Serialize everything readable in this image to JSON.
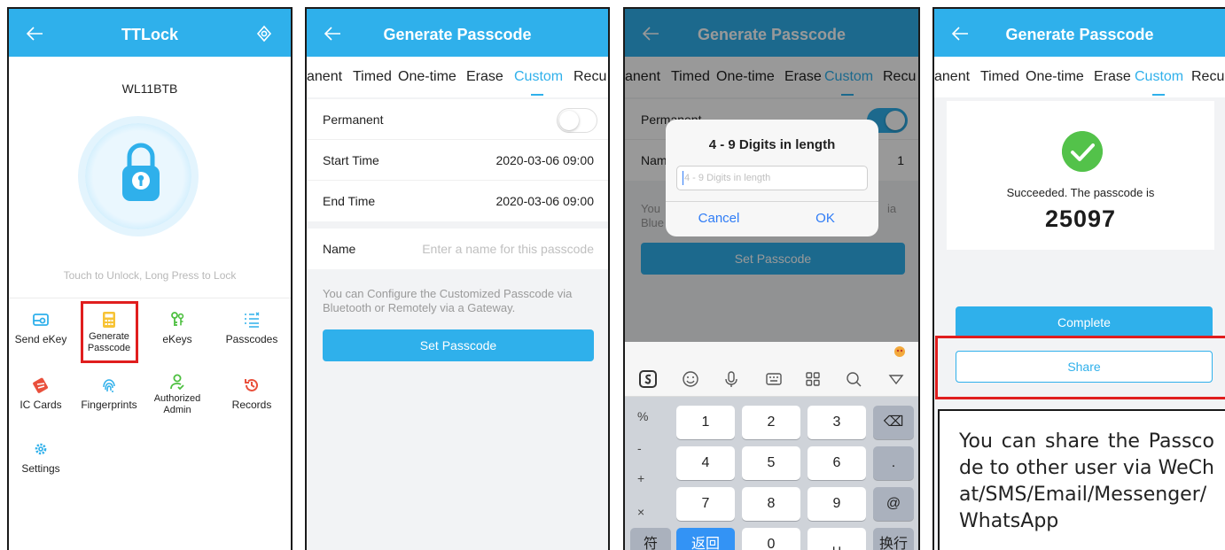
{
  "panel1": {
    "title": "TTLock",
    "lock_name": "WL11BTB",
    "unlock_hint": "Touch to Unlock, Long Press to Lock",
    "grid": [
      {
        "label": "Send eKey",
        "icon": "send-ekey-icon"
      },
      {
        "label": "Generate Passcode",
        "icon": "calculator-icon"
      },
      {
        "label": "eKeys",
        "icon": "keys-icon"
      },
      {
        "label": "Passcodes",
        "icon": "passcodes-list-icon"
      },
      {
        "label": "IC Cards",
        "icon": "ic-card-icon"
      },
      {
        "label": "Fingerprints",
        "icon": "fingerprint-icon"
      },
      {
        "label": "Authorized Admin",
        "icon": "admin-user-icon"
      },
      {
        "label": "Records",
        "icon": "records-history-icon"
      },
      {
        "label": "Settings",
        "icon": "settings-gear-icon"
      }
    ],
    "colors": {
      "header": "#2fb0eb",
      "highlight": "#e01e1e"
    }
  },
  "panel2": {
    "title": "Generate Passcode",
    "tabs": [
      "anent",
      "Timed",
      "One-time",
      "Erase",
      "Custom",
      "Recu"
    ],
    "active_tab": "Custom",
    "permanent_label": "Permanent",
    "start_label": "Start Time",
    "start_value": "2020-03-06 09:00",
    "end_label": "End Time",
    "end_value": "2020-03-06 09:00",
    "name_label": "Name",
    "name_placeholder": "Enter a name for this passcode",
    "note": "You can Configure the Customized Passcode via Bluetooth or Remotely via a Gateway.",
    "button": "Set Passcode"
  },
  "panel3": {
    "title": "Generate Passcode",
    "tabs": [
      "anent",
      "Timed",
      "One-time",
      "Erase",
      "Custom",
      "Recu"
    ],
    "bg_permanent": "Permanent",
    "bg_name": "Nam",
    "bg_name_value": "1",
    "bg_note_left1": "You",
    "bg_note_left2": "Blue",
    "bg_note_right": "ia",
    "bg_button": "Set Passcode",
    "dialog_title": "4 - 9 Digits in length",
    "dialog_placeholder": "4 - 9 Digits in length",
    "dialog_cancel": "Cancel",
    "dialog_ok": "OK",
    "keyboard": {
      "side": [
        "%",
        "-",
        "+",
        "×"
      ],
      "rows": [
        [
          "1",
          "2",
          "3"
        ],
        [
          "4",
          "5",
          "6"
        ],
        [
          "7",
          "8",
          "9"
        ]
      ],
      "right": [
        "⌫",
        ".",
        "@"
      ],
      "bottom": [
        "符",
        "返回",
        "0",
        "␣",
        "换行"
      ]
    }
  },
  "panel4": {
    "title": "Generate Passcode",
    "tabs": [
      "anent",
      "Timed",
      "One-time",
      "Erase",
      "Custom",
      "Recu"
    ],
    "success_text": "Succeeded. The passcode is",
    "passcode": "25097",
    "complete_button": "Complete",
    "share_button": "Share",
    "share_note": "You can share the Passcode to other user via WeChat/SMS/Email/Messenger/WhatsApp"
  }
}
